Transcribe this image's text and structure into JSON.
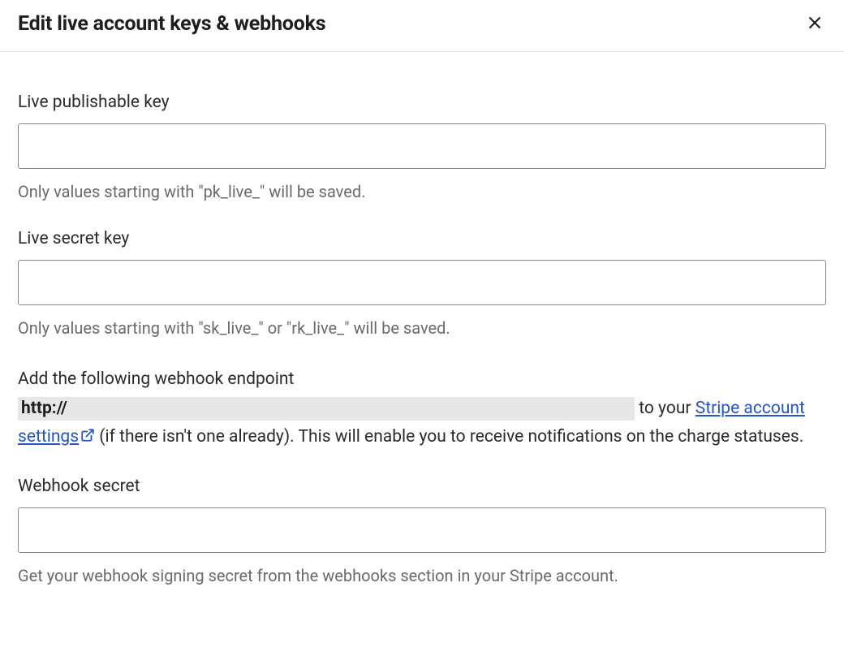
{
  "header": {
    "title": "Edit live account keys & webhooks"
  },
  "fields": {
    "publishable": {
      "label": "Live publishable key",
      "value": "",
      "helper": "Only values starting with \"pk_live_\" will be saved."
    },
    "secret": {
      "label": "Live secret key",
      "value": "",
      "helper": "Only values starting with \"sk_live_\" or \"rk_live_\" will be saved."
    },
    "webhook_secret": {
      "label": "Webhook secret",
      "value": "",
      "helper": "Get your webhook signing secret from the webhooks section in your Stripe account."
    }
  },
  "webhook_instructions": {
    "intro": "Add the following webhook endpoint",
    "url_prefix": "http://",
    "to_your": " to your ",
    "link_text": "Stripe account settings",
    "after_link": " (if there isn't one already). This will enable you to receive notifications on the charge statuses."
  }
}
